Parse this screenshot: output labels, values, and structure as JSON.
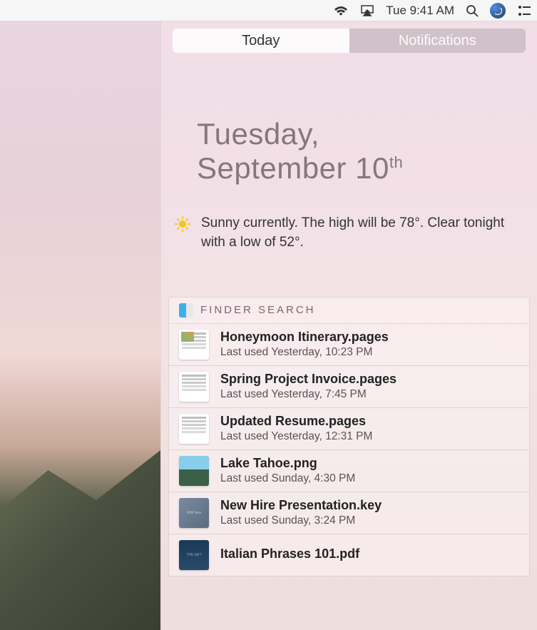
{
  "menubar": {
    "clock": "Tue 9:41 AM"
  },
  "tabs": {
    "today": "Today",
    "notifications": "Notifications"
  },
  "date": {
    "line1": "Tuesday,",
    "line2_pre": "September 10",
    "line2_ord": "th"
  },
  "weather": {
    "text": "Sunny currently. The high will be 78°.  Clear tonight with a low of 52°."
  },
  "finder": {
    "title": "FINDER SEARCH",
    "items": [
      {
        "name": "Honeymoon Itinerary.pages",
        "meta": "Last used Yesterday, 10:23 PM",
        "thumb": "doc-color"
      },
      {
        "name": "Spring Project Invoice.pages",
        "meta": "Last used Yesterday, 7:45 PM",
        "thumb": "doc"
      },
      {
        "name": "Updated Resume.pages",
        "meta": "Last used Yesterday, 12:31 PM",
        "thumb": "doc"
      },
      {
        "name": "Lake Tahoe.png",
        "meta": "Last used Sunday, 4:30 PM",
        "thumb": "photo"
      },
      {
        "name": "New Hire Presentation.key",
        "meta": "Last used Sunday, 3:24 PM",
        "thumb": "keynote"
      },
      {
        "name": "Italian Phrases 101.pdf",
        "meta": "",
        "thumb": "pdf"
      }
    ]
  }
}
